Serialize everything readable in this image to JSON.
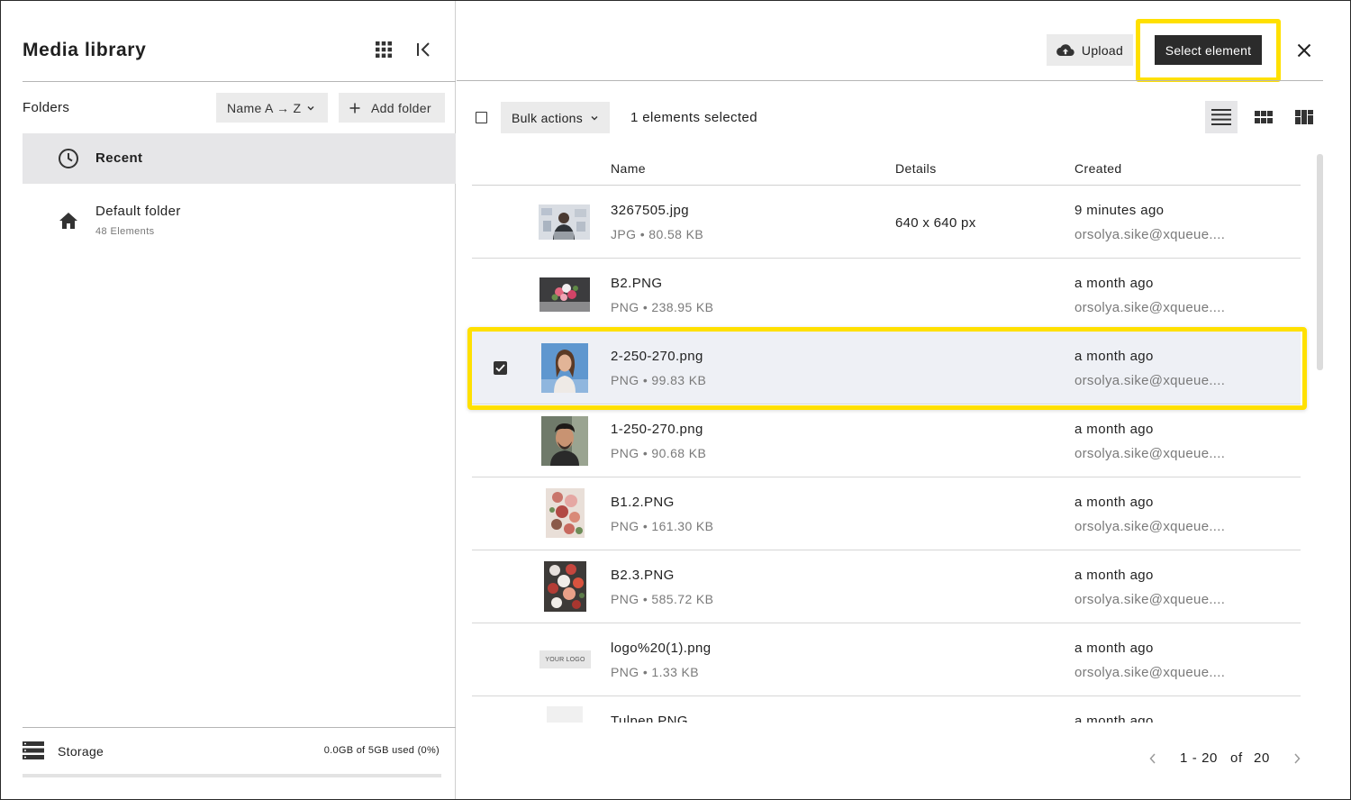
{
  "header": {
    "title": "Media library",
    "upload_label": "Upload",
    "select_label": "Select element"
  },
  "folders": {
    "label": "Folders",
    "sort_label": "Name A → Z",
    "add_label": "Add folder",
    "items": [
      {
        "name": "Recent",
        "sub": "",
        "icon": "clock-icon",
        "active": true
      },
      {
        "name": "Default folder",
        "sub": "48 Elements",
        "icon": "home-icon",
        "active": false
      }
    ]
  },
  "storage": {
    "label": "Storage",
    "value": "0.0GB of 5GB used (0%)",
    "used_fraction": 0
  },
  "toolbar": {
    "bulk_label": "Bulk actions",
    "selected_text": "1 elements selected",
    "views": [
      "list-view-icon",
      "grid-view-icon",
      "mosaic-view-icon"
    ],
    "active_view": "list-view-icon"
  },
  "table": {
    "columns": {
      "name": "Name",
      "details": "Details",
      "created": "Created"
    },
    "rows": [
      {
        "name": "3267505.jpg",
        "meta": "JPG • 80.58 KB",
        "details": "640 x 640 px",
        "created": "9 minutes ago",
        "user": "orsolya.sike@xqueue....",
        "selected": false
      },
      {
        "name": "B2.PNG",
        "meta": "PNG • 238.95 KB",
        "details": "",
        "created": "a month ago",
        "user": "orsolya.sike@xqueue....",
        "selected": false
      },
      {
        "name": "2-250-270.png",
        "meta": "PNG • 99.83 KB",
        "details": "",
        "created": "a month ago",
        "user": "orsolya.sike@xqueue....",
        "selected": true
      },
      {
        "name": "1-250-270.png",
        "meta": "PNG • 90.68 KB",
        "details": "",
        "created": "a month ago",
        "user": "orsolya.sike@xqueue....",
        "selected": false
      },
      {
        "name": "B1.2.PNG",
        "meta": "PNG • 161.30 KB",
        "details": "",
        "created": "a month ago",
        "user": "orsolya.sike@xqueue....",
        "selected": false
      },
      {
        "name": "B2.3.PNG",
        "meta": "PNG • 585.72 KB",
        "details": "",
        "created": "a month ago",
        "user": "orsolya.sike@xqueue....",
        "selected": false
      },
      {
        "name": "logo%20(1).png",
        "meta": "PNG • 1.33 KB",
        "details": "",
        "created": "a month ago",
        "user": "orsolya.sike@xqueue....",
        "selected": false
      },
      {
        "name": "Tulpen.PNG",
        "meta": "",
        "details": "",
        "created": "a month ago",
        "user": "",
        "selected": false
      }
    ],
    "logo_thumb_text": "YOUR LOGO"
  },
  "pagination": {
    "range": "1 - 20",
    "of": "of",
    "total": "20"
  },
  "colors": {
    "highlight": "#ffe000",
    "primary_button": "#2b2b2b",
    "selected_row": "#eef0f5"
  }
}
